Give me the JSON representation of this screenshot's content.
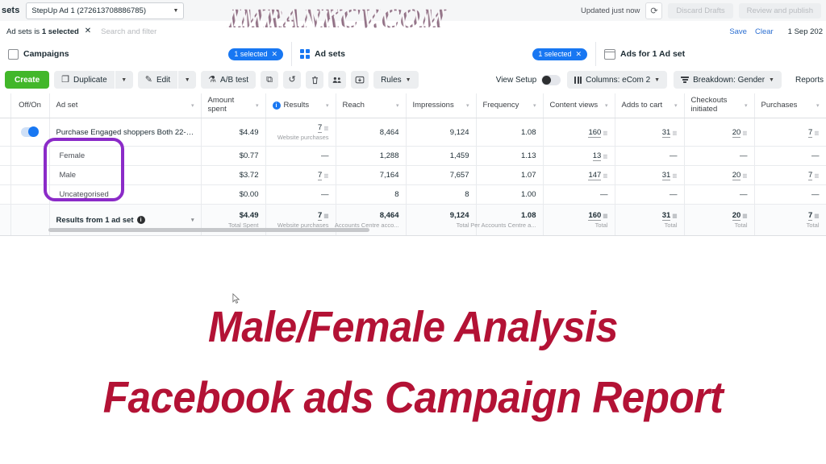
{
  "topbar": {
    "section_label": "sets",
    "account_select": "StepUp Ad 1 (272613708886785)",
    "caret": "▼",
    "updated_text": "Updated just now",
    "refresh_icon": "⟳",
    "discard_label": "Discard Drafts",
    "publish_label": "Review and publish"
  },
  "filterbar": {
    "chip_prefix": "Ad sets is ",
    "chip_strong": "1 selected",
    "chip_close": "✕",
    "search_placeholder": "Search and filter",
    "save_label": "Save",
    "clear_label": "Clear",
    "date_label": "1 Sep 202"
  },
  "objtabs": [
    {
      "label": "Campaigns",
      "pill": "1 selected",
      "pill_close": "✕",
      "icon": "square-icon"
    },
    {
      "label": "Ad sets",
      "pill": "1 selected",
      "pill_close": "✕",
      "icon": "grid-icon"
    },
    {
      "label": "Ads for 1 Ad set",
      "pill": "",
      "pill_close": "",
      "icon": "window-icon"
    }
  ],
  "toolbar": {
    "create_label": "Create",
    "duplicate_label": "Duplicate",
    "edit_label": "Edit",
    "abtest_label": "A/B test",
    "rules_label": "Rules",
    "duplicate_icon": "❐",
    "edit_icon": "✎",
    "abtest_icon": "⚗",
    "copy_icon": "⧉",
    "undo_icon": "↺",
    "trash_icon": "Ὕ1",
    "audience_icon": "٩(●)",
    "export_icon": "⤓",
    "caret": "▼",
    "view_setup_label": "View Setup",
    "columns_label": "Columns: eCom 2",
    "breakdown_label": "Breakdown: Gender",
    "reports_label": "Reports"
  },
  "table": {
    "columns": [
      {
        "label": "Off/On",
        "align": "center",
        "sortable": false,
        "info": false
      },
      {
        "label": "Ad set",
        "align": "left",
        "sortable": true,
        "info": false
      },
      {
        "label": "Amount spent",
        "align": "right",
        "sortable": true,
        "info": false
      },
      {
        "label": "Results",
        "align": "left",
        "sortable": true,
        "info": true
      },
      {
        "label": "Reach",
        "align": "left",
        "sortable": true,
        "info": false
      },
      {
        "label": "Impressions",
        "align": "left",
        "sortable": true,
        "info": false
      },
      {
        "label": "Frequency",
        "align": "left",
        "sortable": true,
        "info": false
      },
      {
        "label": "Content views",
        "align": "left",
        "sortable": true,
        "info": false
      },
      {
        "label": "Adds to cart",
        "align": "left",
        "sortable": true,
        "info": false
      },
      {
        "label": "Checkouts initiated",
        "align": "left",
        "sortable": true,
        "info": false
      },
      {
        "label": "Purchases",
        "align": "left",
        "sortable": true,
        "info": false
      }
    ],
    "rows": [
      {
        "type": "adset",
        "toggle_on": true,
        "name": "Purchase Engaged shoppers Both 22-54 Sale...",
        "amount_spent": "$4.49",
        "results": "7",
        "results_sub": "Website purchases",
        "reach": "8,464",
        "impressions": "9,124",
        "frequency": "1.08",
        "content_views": "160",
        "adds_to_cart": "31",
        "checkouts_initiated": "20",
        "purchases": "7"
      },
      {
        "type": "breakdown",
        "name": "Female",
        "amount_spent": "$0.77",
        "results": "—",
        "results_sub": "",
        "reach": "1,288",
        "impressions": "1,459",
        "frequency": "1.13",
        "content_views": "13",
        "adds_to_cart": "—",
        "checkouts_initiated": "—",
        "purchases": "—"
      },
      {
        "type": "breakdown",
        "name": "Male",
        "amount_spent": "$3.72",
        "results": "7",
        "results_sub": "",
        "reach": "7,164",
        "impressions": "7,657",
        "frequency": "1.07",
        "content_views": "147",
        "adds_to_cart": "31",
        "checkouts_initiated": "20",
        "purchases": "7"
      },
      {
        "type": "breakdown",
        "name": "Uncategorised",
        "amount_spent": "$0.00",
        "results": "—",
        "results_sub": "",
        "reach": "8",
        "impressions": "8",
        "frequency": "1.00",
        "content_views": "—",
        "adds_to_cart": "—",
        "checkouts_initiated": "—",
        "purchases": "—"
      }
    ],
    "totals": {
      "label": "Results from 1 ad set",
      "amount_spent": "$4.49",
      "amount_spent_sub": "Total Spent",
      "results": "7",
      "results_sub": "Website purchases",
      "reach": "8,464",
      "reach_sub": "Accounts Centre acco...",
      "impressions": "9,124",
      "impressions_sub": "Total",
      "frequency": "1.08",
      "frequency_sub": "Per Accounts Centre a...",
      "content_views": "160",
      "content_views_sub": "Total",
      "adds_to_cart": "31",
      "adds_to_cart_sub": "Total",
      "checkouts_initiated": "20",
      "checkouts_initiated_sub": "Total",
      "purchases": "7",
      "purchases_sub": "Total"
    }
  },
  "overlay": {
    "watermark": "IMRANKCV.COM",
    "title_line1": "Male/Female Analysis",
    "title_line2": "Facebook ads Campaign Report",
    "title_color": "#b31235",
    "highlight_color": "#8b2bc8"
  }
}
